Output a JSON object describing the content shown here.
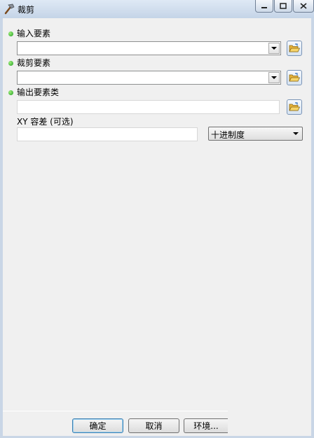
{
  "window": {
    "title": "裁剪"
  },
  "fields": {
    "input_features": {
      "label": "输入要素",
      "value": ""
    },
    "clip_features": {
      "label": "裁剪要素",
      "value": ""
    },
    "output_feature_class": {
      "label": "输出要素类",
      "value": ""
    },
    "xy_tolerance": {
      "label": "XY 容差 (可选)",
      "value": ""
    },
    "units": {
      "selected": "十进制度"
    }
  },
  "buttons": {
    "ok": "确定",
    "cancel": "取消",
    "environments": "环境..."
  },
  "icons": {
    "title": "hammer-icon",
    "required": "required-dot-icon",
    "browse": "open-folder-icon"
  },
  "colors": {
    "required_dot": "#2faa2f",
    "title_bar": "#c4d4e7"
  }
}
